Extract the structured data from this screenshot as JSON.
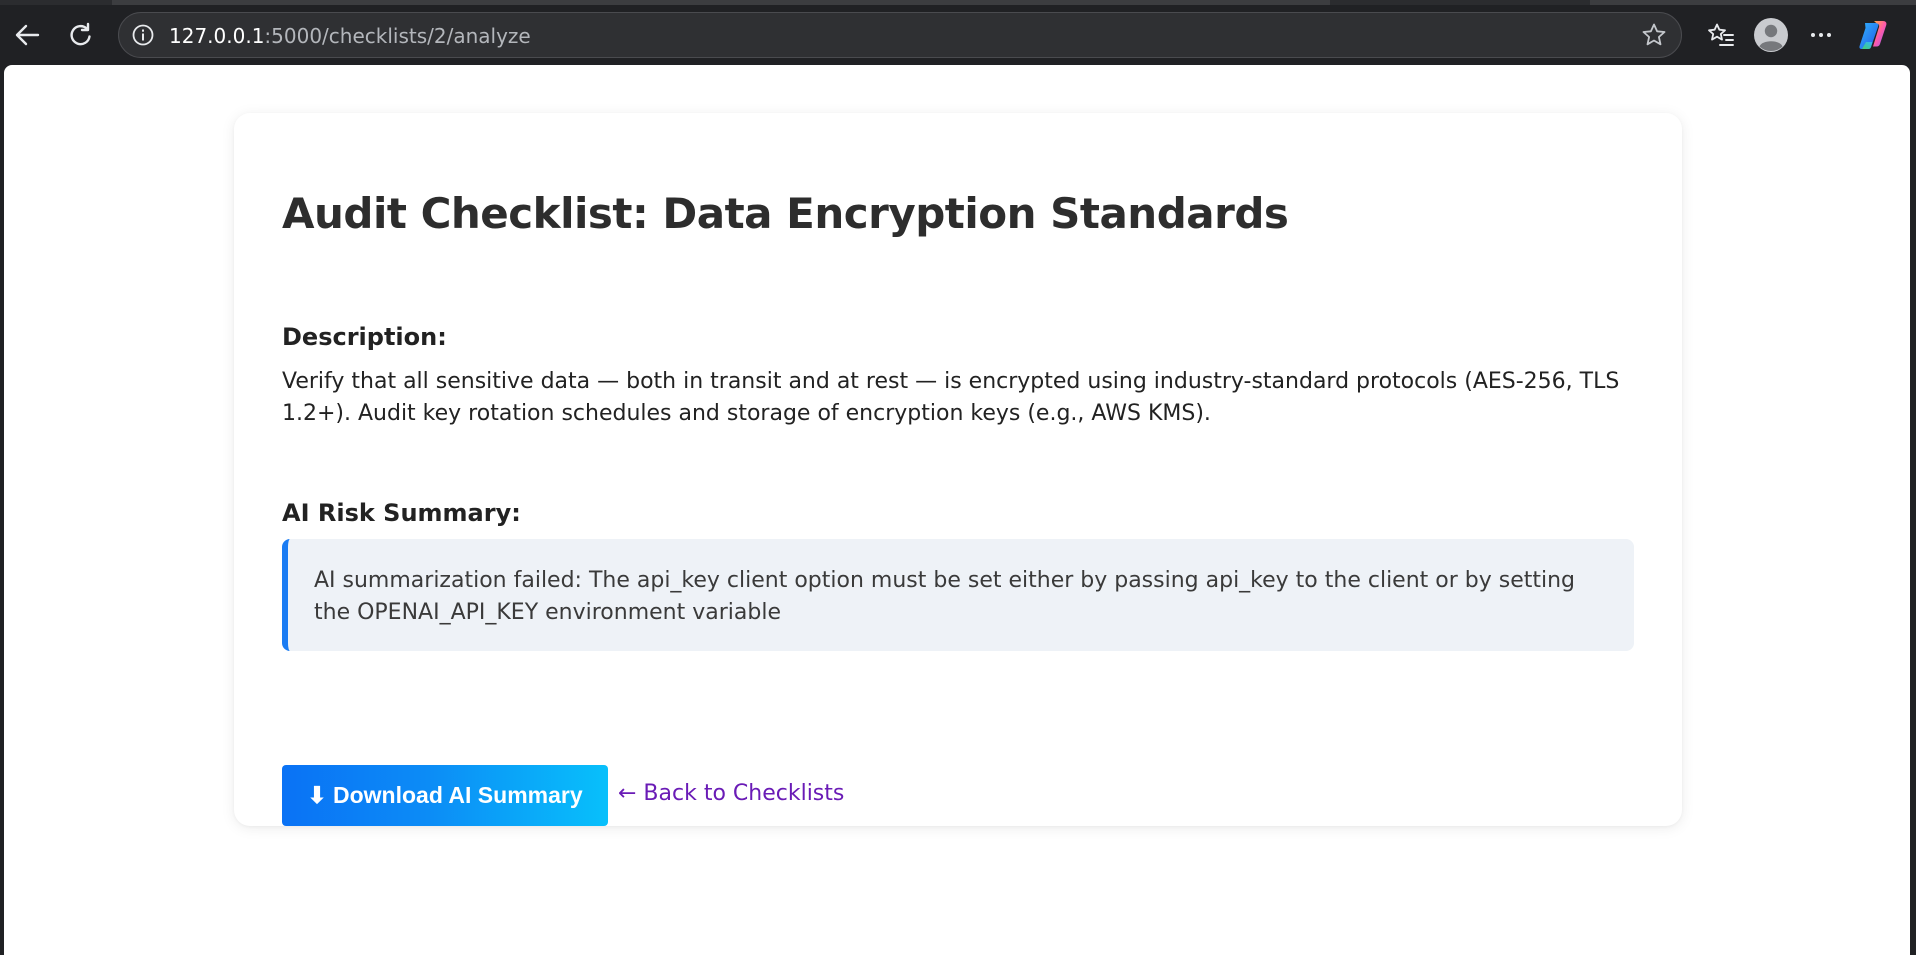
{
  "browser": {
    "url_host": "127.0.0.1",
    "url_path": ":5000/checklists/2/analyze",
    "icons": {
      "back": "back-arrow-icon",
      "reload": "reload-icon",
      "site_info": "info-icon",
      "bookmark": "star-icon",
      "favorites": "favorites-icon",
      "profile": "profile-avatar-icon",
      "menu": "more-menu-icon",
      "copilot": "copilot-icon"
    }
  },
  "page": {
    "title": "Audit Checklist: Data Encryption Standards",
    "description_heading": "Description:",
    "description_text": "Verify that all sensitive data — both in transit and at rest — is encrypted using industry-standard protocols (AES-256, TLS 1.2+). Audit key rotation schedules and storage of encryption keys (e.g., AWS KMS).",
    "risk_heading": "AI Risk Summary:",
    "risk_text": "AI summarization failed: The api_key client option must be set either by passing api_key to the client or by setting the OPENAI_API_KEY environment variable",
    "download_button": "⬇ Download AI Summary",
    "back_link": "← Back to Checklists"
  },
  "colors": {
    "accent_blue": "#1a7cf3",
    "button_gradient_start": "#0a72f5",
    "button_gradient_end": "#08c0fb",
    "link_visited": "#6a1bb6",
    "risk_box_bg": "#eef2f7"
  }
}
